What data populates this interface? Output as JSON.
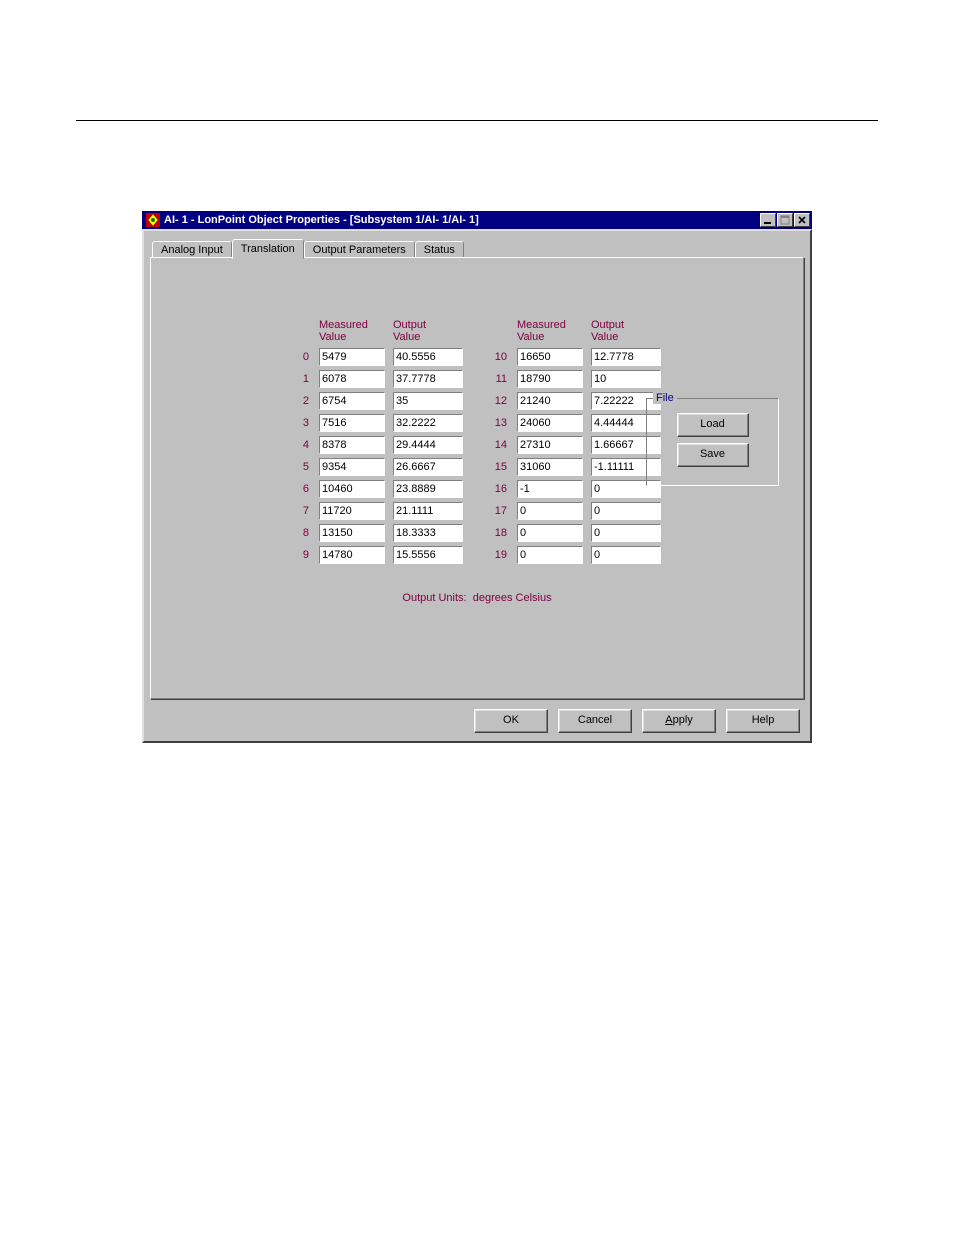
{
  "window": {
    "title": "AI- 1 - LonPoint Object Properties - [Subsystem 1/AI- 1/AI- 1]"
  },
  "tabs": {
    "t0": "Analog Input",
    "t1": "Translation",
    "t2": "Output Parameters",
    "t3": "Status",
    "active_index": 1
  },
  "headers": {
    "measured1": "Measured",
    "measured2": "Value",
    "output1": "Output",
    "output2": "Value"
  },
  "left": {
    "idx": [
      "0",
      "1",
      "2",
      "3",
      "4",
      "5",
      "6",
      "7",
      "8",
      "9"
    ],
    "measured": [
      "5479",
      "6078",
      "6754",
      "7516",
      "8378",
      "9354",
      "10460",
      "11720",
      "13150",
      "14780"
    ],
    "output": [
      "40.5556",
      "37.7778",
      "35",
      "32.2222",
      "29.4444",
      "26.6667",
      "23.8889",
      "21.1111",
      "18.3333",
      "15.5556"
    ]
  },
  "right": {
    "idx": [
      "10",
      "11",
      "12",
      "13",
      "14",
      "15",
      "16",
      "17",
      "18",
      "19"
    ],
    "measured": [
      "16650",
      "18790",
      "21240",
      "24060",
      "27310",
      "31060",
      "-1",
      "0",
      "0",
      "0"
    ],
    "output": [
      "12.7778",
      "10",
      "7.22222",
      "4.44444",
      "1.66667",
      "-1.11111",
      "0",
      "0",
      "0",
      "0"
    ]
  },
  "file_group": {
    "legend": "File",
    "load": "Load",
    "save": "Save"
  },
  "output_units": {
    "label": "Output Units:",
    "value": "degrees Celsius"
  },
  "buttons": {
    "ok": "OK",
    "cancel": "Cancel",
    "apply_prefix": "A",
    "apply_rest": "pply",
    "help": "Help"
  }
}
